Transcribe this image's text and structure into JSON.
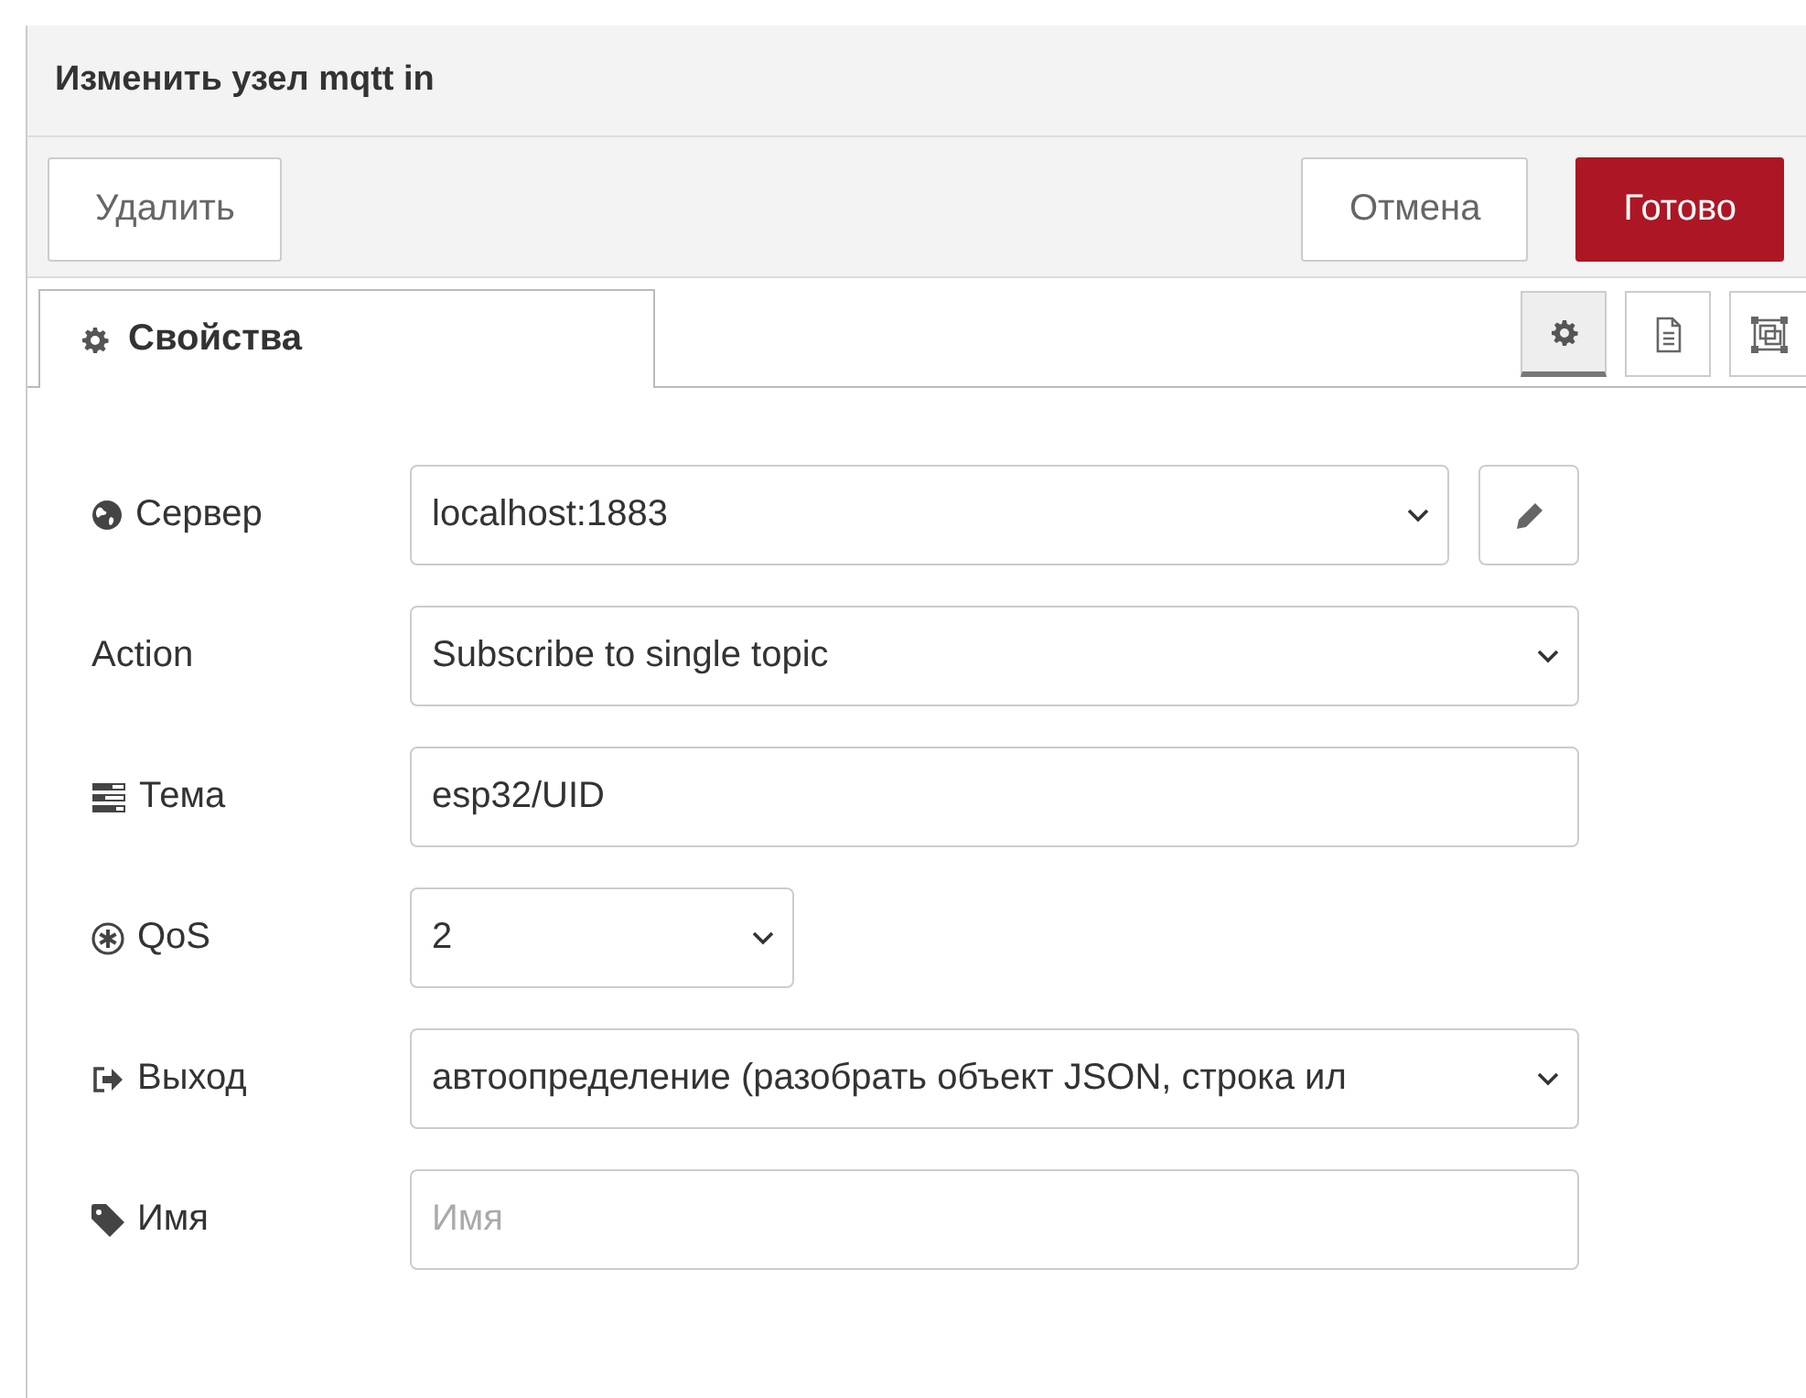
{
  "window": {
    "title": "Изменить узел mqtt in"
  },
  "toolbar": {
    "delete": "Удалить",
    "cancel": "Отмена",
    "done": "Готово"
  },
  "tabs": [
    {
      "label": "Свойства",
      "selected": true
    }
  ],
  "side_tabs": [
    {
      "kind": "gear",
      "selected": true
    },
    {
      "kind": "document",
      "selected": false
    },
    {
      "kind": "frame",
      "selected": false
    }
  ],
  "fields": [
    {
      "kind": "editable_select",
      "label": "Сервер",
      "value": "localhost:1883"
    },
    {
      "kind": "select",
      "label": "Action",
      "value": "Subscribe to single topic"
    },
    {
      "kind": "text",
      "label": "Тема",
      "value": "esp32/UID"
    },
    {
      "kind": "short_select",
      "label": "QoS",
      "value": "2"
    },
    {
      "kind": "select",
      "label": "Выход",
      "value": "автоопределение (разобрать объект JSON, строка ил"
    },
    {
      "kind": "text",
      "label": "Имя",
      "placeholder": "Имя"
    }
  ]
}
